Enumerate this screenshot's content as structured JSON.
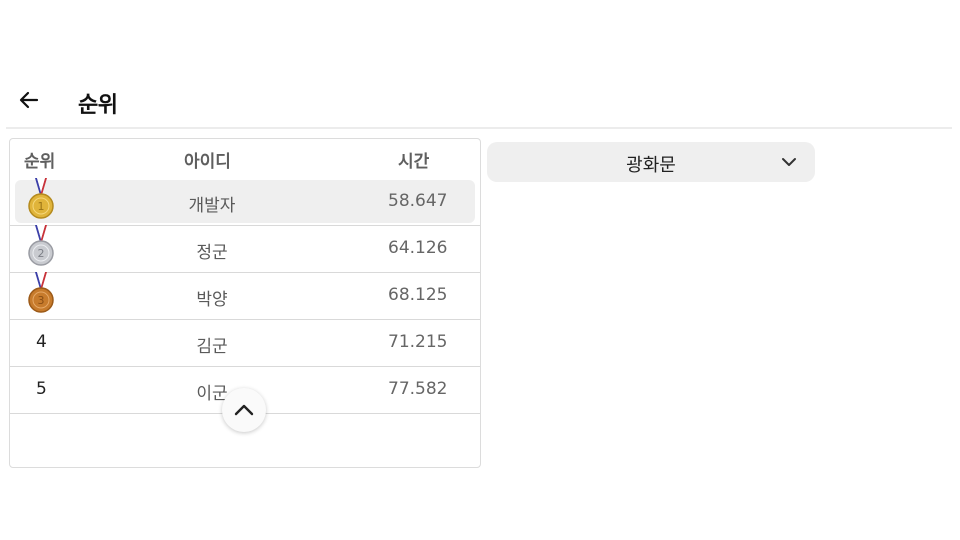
{
  "header": {
    "title": "순위",
    "back_icon": "arrow-left-icon"
  },
  "table": {
    "columns": {
      "rank": "순위",
      "id": "아이디",
      "time": "시간"
    },
    "rows": [
      {
        "rank": "1",
        "medal": "gold-medal-icon",
        "id": "개발자",
        "time": "58.647"
      },
      {
        "rank": "2",
        "medal": "silver-medal-icon",
        "id": "정군",
        "time": "64.126"
      },
      {
        "rank": "3",
        "medal": "bronze-medal-icon",
        "id": "박양",
        "time": "68.125"
      },
      {
        "rank": "4",
        "id": "김군",
        "time": "71.215"
      },
      {
        "rank": "5",
        "id": "이군",
        "time": "77.582"
      }
    ]
  },
  "location_select": {
    "value": "광화문",
    "icon": "chevron-down-icon"
  },
  "scroll_button": {
    "icon": "chevron-up-icon"
  },
  "colors": {
    "highlight_row": "#efefef",
    "select_bg": "#efefef",
    "gold": "#e0b43a",
    "silver": "#c9cbd0",
    "bronze": "#c77b2c"
  }
}
